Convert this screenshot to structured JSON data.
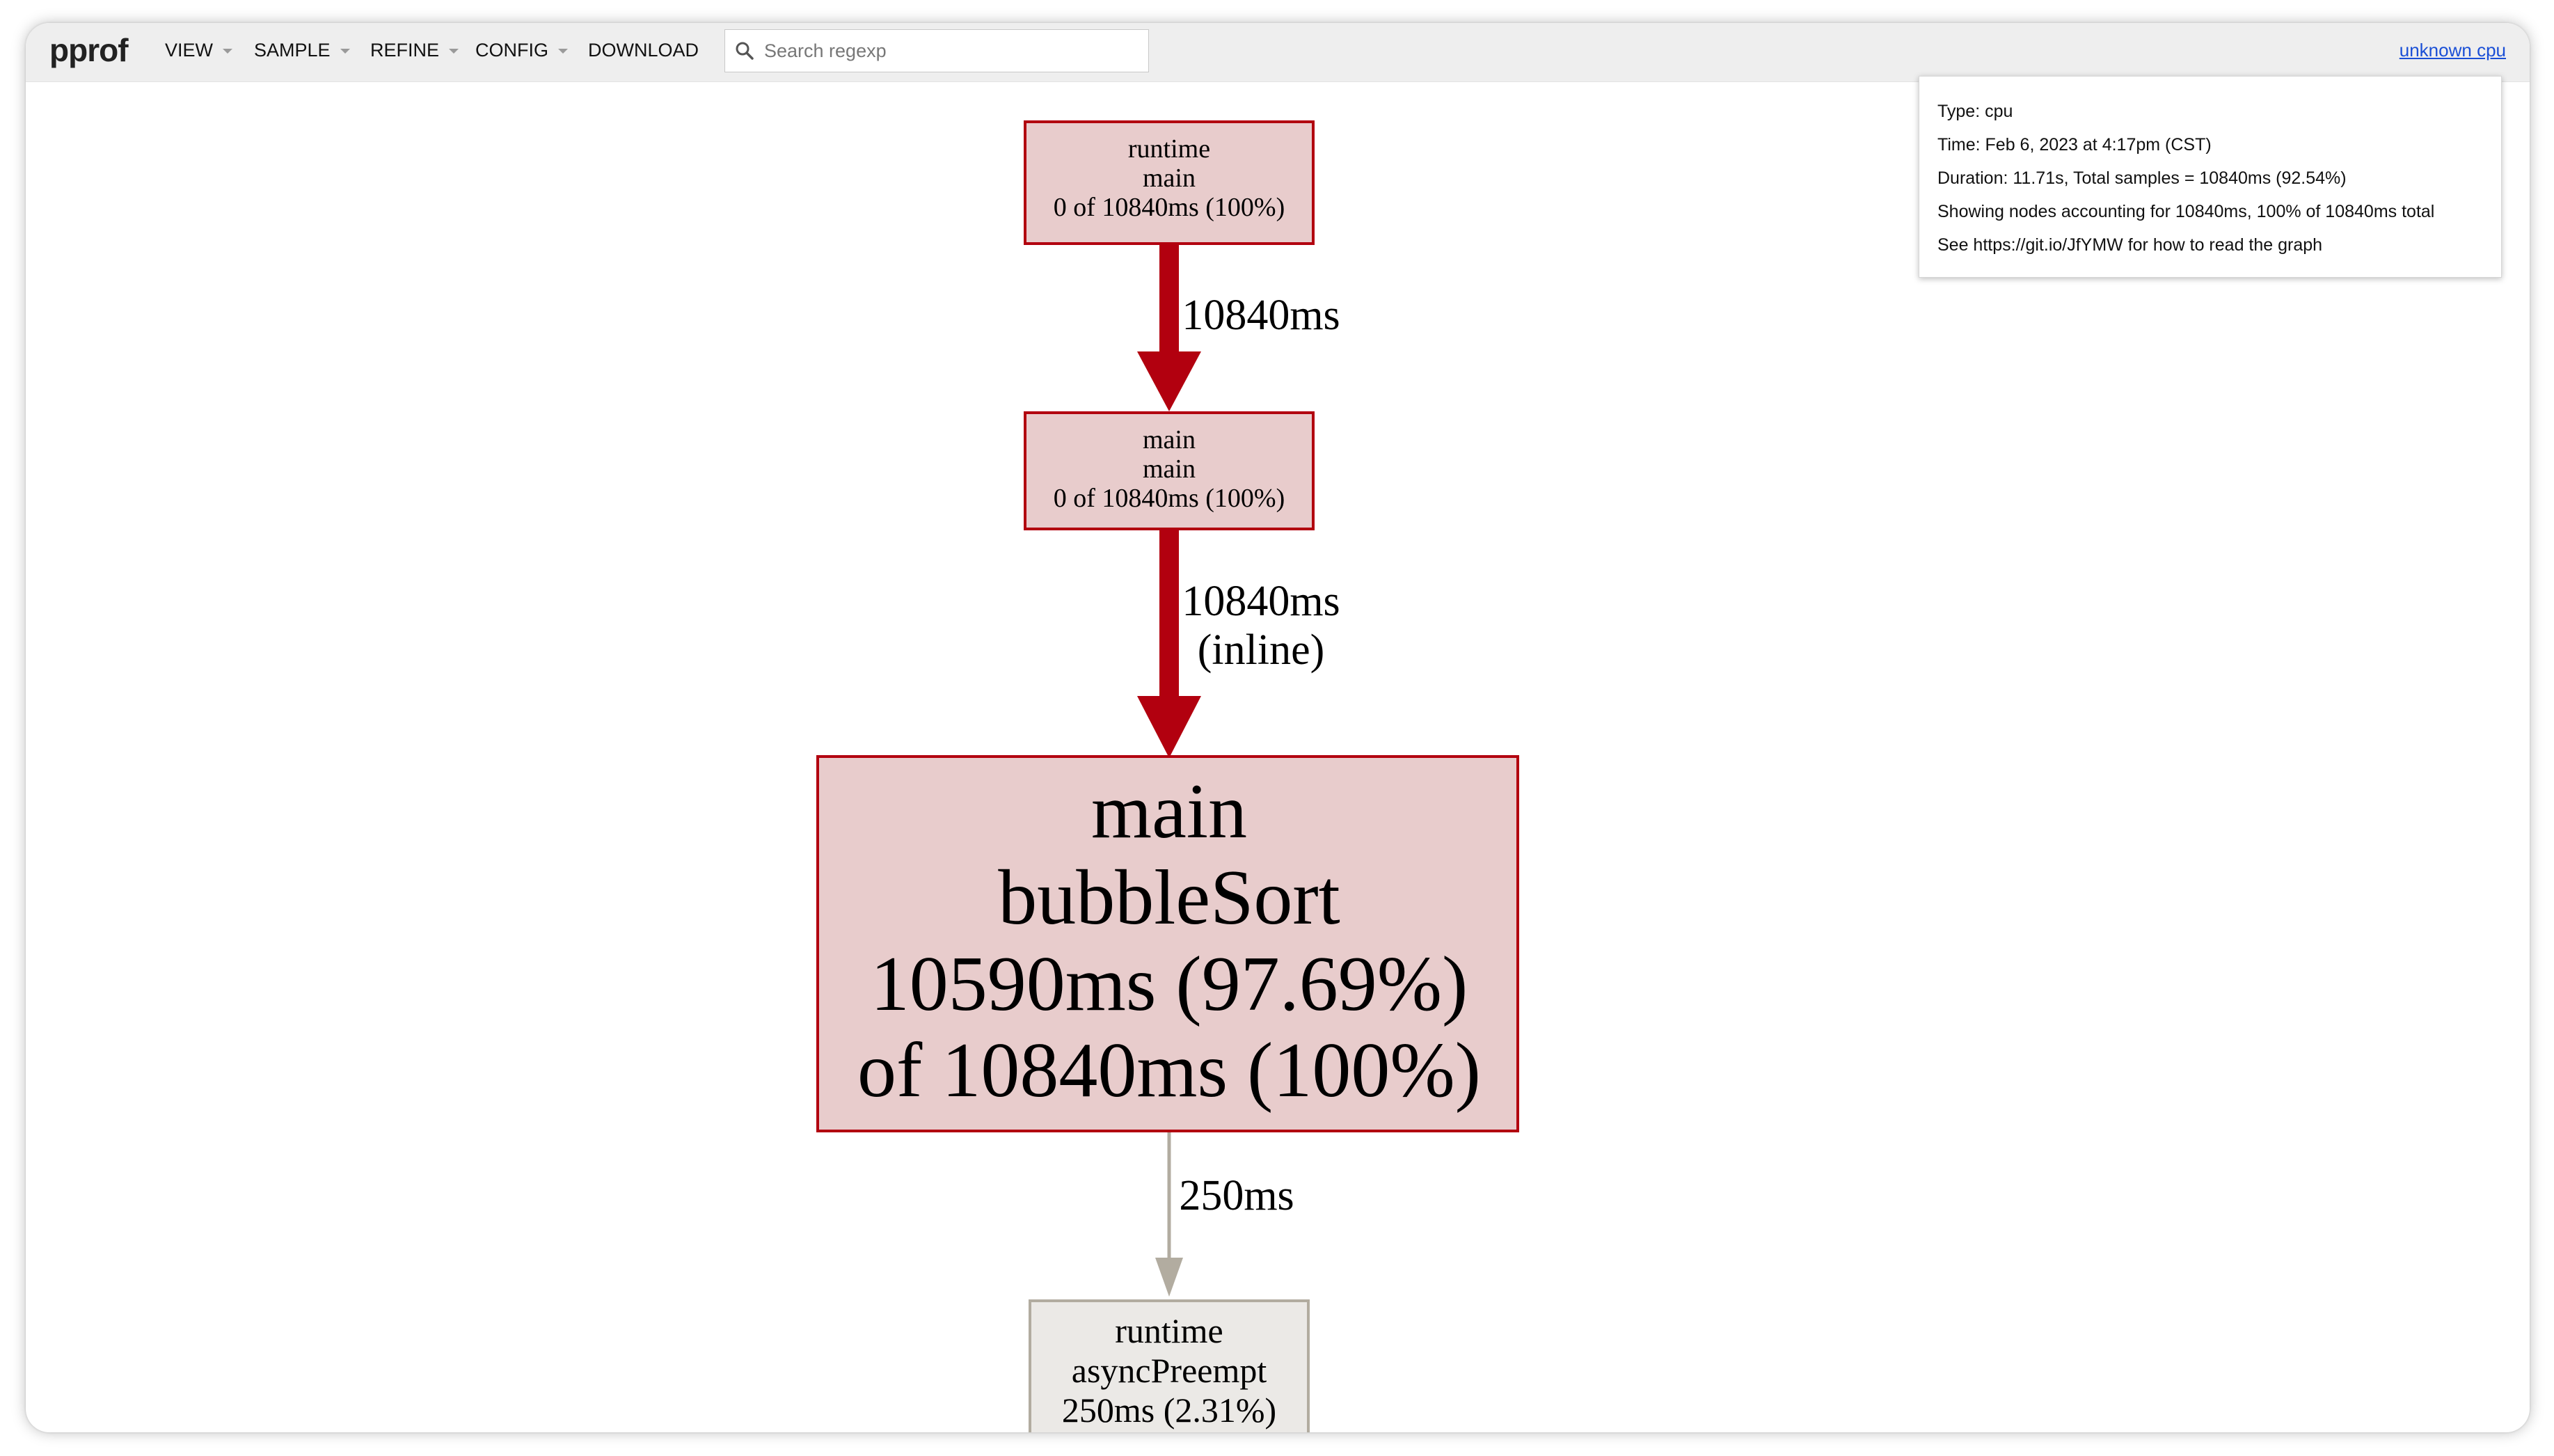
{
  "app": {
    "logo": "pprof",
    "profile_link": "unknown cpu"
  },
  "menu": {
    "view": "VIEW",
    "sample": "SAMPLE",
    "refine": "REFINE",
    "config": "CONFIG",
    "download": "DOWNLOAD"
  },
  "search": {
    "placeholder": "Search regexp",
    "icon": "search-icon"
  },
  "legend": {
    "lines": [
      "Type: cpu",
      "Time: Feb 6, 2023 at 4:17pm (CST)",
      "Duration: 11.71s, Total samples = 10840ms (92.54%)",
      "Showing nodes accounting for 10840ms, 100% of 10840ms total",
      "See https://git.io/JfYMW for how to read the graph"
    ]
  },
  "graph": {
    "nodes": [
      {
        "id": "runtime-main",
        "lines": [
          "runtime",
          "main",
          "0 of 10840ms (100%)"
        ],
        "fill": "#e8cccc",
        "stroke": "#b2000f"
      },
      {
        "id": "main-main",
        "lines": [
          "main",
          "main",
          "0 of 10840ms (100%)"
        ],
        "fill": "#e8cccc",
        "stroke": "#b2000f"
      },
      {
        "id": "main-bubblesort",
        "lines": [
          "main",
          "bubbleSort",
          "10590ms (97.69%)",
          "of 10840ms (100%)"
        ],
        "fill": "#e8cccc",
        "stroke": "#b2000f"
      },
      {
        "id": "runtime-asyncpreempt",
        "lines": [
          "runtime",
          "asyncPreempt",
          "250ms (2.31%)"
        ],
        "fill": "#ebe9e6",
        "stroke": "#b2aca0"
      }
    ],
    "edges": [
      {
        "from": "runtime-main",
        "to": "main-main",
        "lines": [
          "10840ms"
        ],
        "color": "#b2000f"
      },
      {
        "from": "main-main",
        "to": "main-bubblesort",
        "lines": [
          "10840ms",
          "(inline)"
        ],
        "color": "#b2000f"
      },
      {
        "from": "main-bubblesort",
        "to": "runtime-asyncpreempt",
        "lines": [
          "250ms"
        ],
        "color": "#b2aca0"
      }
    ]
  }
}
